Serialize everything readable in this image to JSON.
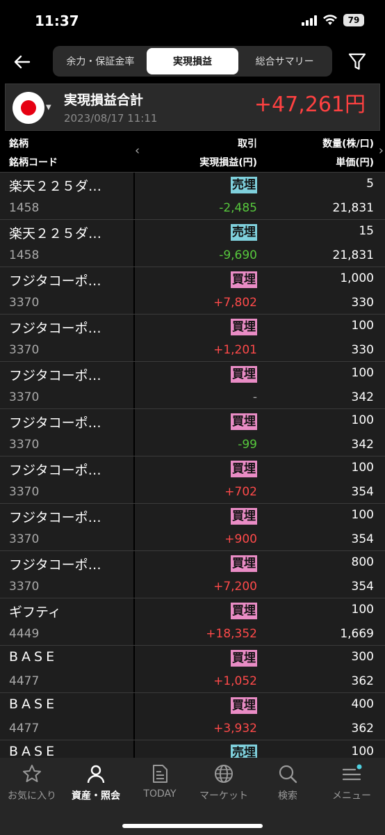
{
  "status": {
    "time": "11:37",
    "battery": "79"
  },
  "nav": {
    "tabs": [
      {
        "label": "余力・保証金率",
        "active": false
      },
      {
        "label": "実現損益",
        "active": true
      },
      {
        "label": "総合サマリー",
        "active": false
      }
    ]
  },
  "summary": {
    "title": "実現損益合計",
    "date": "2023/08/17 11:11",
    "amount": "+47,261円"
  },
  "table": {
    "headers": {
      "name": "銘柄",
      "code": "銘柄コード",
      "trade": "取引",
      "pl": "実現損益(円)",
      "qty": "数量(株/口)",
      "price": "単価(円)"
    },
    "rows": [
      {
        "name": "楽天２２５ダ…",
        "code": "1458",
        "trade": "売埋",
        "type": "sell",
        "pl": "-2,485",
        "sign": "neg",
        "qty": "5",
        "price": "21,831"
      },
      {
        "name": "楽天２２５ダ…",
        "code": "1458",
        "trade": "売埋",
        "type": "sell",
        "pl": "-9,690",
        "sign": "neg",
        "qty": "15",
        "price": "21,831"
      },
      {
        "name": "フジタコーポ…",
        "code": "3370",
        "trade": "買埋",
        "type": "buy",
        "pl": "+7,802",
        "sign": "pos",
        "qty": "1,000",
        "price": "330"
      },
      {
        "name": "フジタコーポ…",
        "code": "3370",
        "trade": "買埋",
        "type": "buy",
        "pl": "+1,201",
        "sign": "pos",
        "qty": "100",
        "price": "330"
      },
      {
        "name": "フジタコーポ…",
        "code": "3370",
        "trade": "買埋",
        "type": "buy",
        "pl": "-",
        "sign": "zero",
        "qty": "100",
        "price": "342"
      },
      {
        "name": "フジタコーポ…",
        "code": "3370",
        "trade": "買埋",
        "type": "buy",
        "pl": "-99",
        "sign": "neg",
        "qty": "100",
        "price": "342"
      },
      {
        "name": "フジタコーポ…",
        "code": "3370",
        "trade": "買埋",
        "type": "buy",
        "pl": "+702",
        "sign": "pos",
        "qty": "100",
        "price": "354"
      },
      {
        "name": "フジタコーポ…",
        "code": "3370",
        "trade": "買埋",
        "type": "buy",
        "pl": "+900",
        "sign": "pos",
        "qty": "100",
        "price": "354"
      },
      {
        "name": "フジタコーポ…",
        "code": "3370",
        "trade": "買埋",
        "type": "buy",
        "pl": "+7,200",
        "sign": "pos",
        "qty": "800",
        "price": "354"
      },
      {
        "name": "ギフティ",
        "code": "4449",
        "trade": "買埋",
        "type": "buy",
        "pl": "+18,352",
        "sign": "pos",
        "qty": "100",
        "price": "1,669"
      },
      {
        "name": "BASE",
        "code": "4477",
        "trade": "買埋",
        "type": "buy",
        "pl": "+1,052",
        "sign": "pos",
        "qty": "300",
        "price": "362"
      },
      {
        "name": "BASE",
        "code": "4477",
        "trade": "買埋",
        "type": "buy",
        "pl": "+3,932",
        "sign": "pos",
        "qty": "400",
        "price": "362"
      },
      {
        "name": "BASE",
        "code": "",
        "trade": "売埋",
        "type": "sell",
        "pl": "",
        "sign": "zero",
        "qty": "100",
        "price": ""
      }
    ]
  },
  "bottom_nav": [
    {
      "label": "お気に入り",
      "icon": "star-icon",
      "active": false
    },
    {
      "label": "資産・照会",
      "icon": "person-icon",
      "active": true
    },
    {
      "label": "TODAY",
      "icon": "news-icon",
      "active": false
    },
    {
      "label": "マーケット",
      "icon": "globe-icon",
      "active": false
    },
    {
      "label": "検索",
      "icon": "search-icon",
      "active": false
    },
    {
      "label": "メニュー",
      "icon": "menu-icon",
      "active": false
    }
  ],
  "colors": {
    "profit": "#ff4a4a",
    "loss": "#57c93d",
    "sell_badge": "#7fd0dc",
    "buy_badge": "#e98cc5"
  }
}
